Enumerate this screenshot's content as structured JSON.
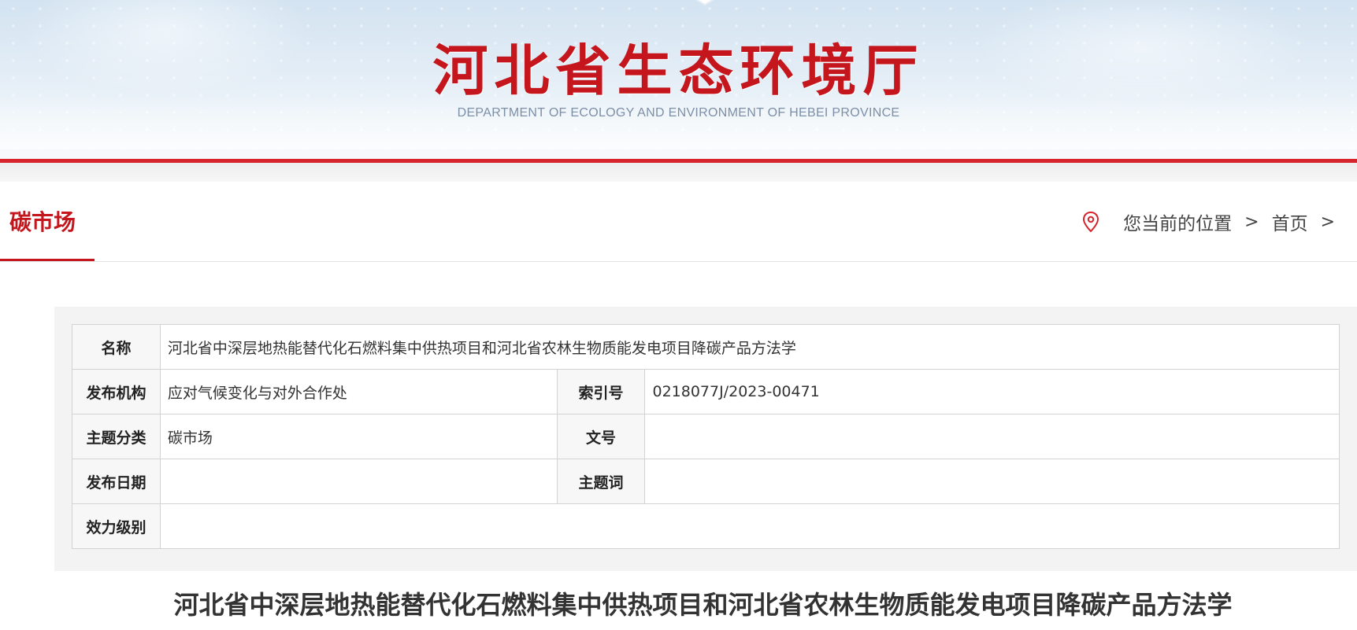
{
  "header": {
    "site_title": "河北省生态环境厅",
    "site_subtitle": "DEPARTMENT OF ECOLOGY AND ENVIRONMENT OF HEBEI PROVINCE"
  },
  "section": {
    "title": "碳市场"
  },
  "breadcrumb": {
    "location_label": "您当前的位置",
    "items": [
      "首页"
    ],
    "separator": ">"
  },
  "metadata": {
    "name_label": "名称",
    "name_value": "河北省中深层地热能替代化石燃料集中供热项目和河北省农林生物质能发电项目降碳产品方法学",
    "publisher_label": "发布机构",
    "publisher_value": "应对气候变化与对外合作处",
    "index_label": "索引号",
    "index_value": "0218077J/2023-00471",
    "topic_label": "主题分类",
    "topic_value": "碳市场",
    "doc_no_label": "文号",
    "doc_no_value": "",
    "date_label": "发布日期",
    "date_value": "",
    "keywords_label": "主题词",
    "keywords_value": "",
    "validity_label": "效力级别",
    "validity_value": ""
  },
  "article": {
    "title": "河北省中深层地热能替代化石燃料集中供热项目和河北省农林生物质能发电项目降碳产品方法学"
  },
  "colors": {
    "brand_red": "#c4161c",
    "banner_blue": "#d3e3f1"
  },
  "icons": {
    "breadcrumb": "location-pin-icon",
    "emblem": "emblem-icon"
  }
}
